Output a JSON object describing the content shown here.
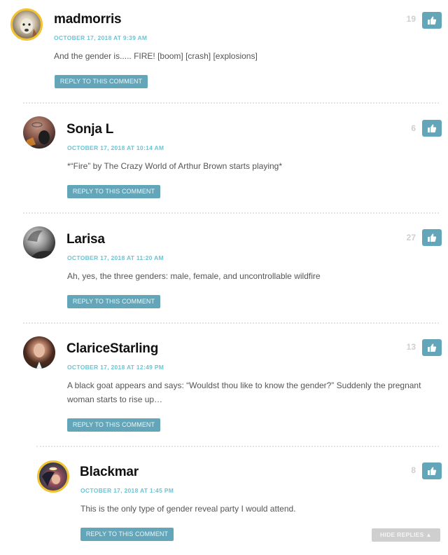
{
  "reply_label": "REPLY TO THIS COMMENT",
  "hide_replies_label": "HIDE REPLIES ▲",
  "accent_color": "#63a6b9",
  "date_color": "#6cc4d4",
  "comments": [
    {
      "author": "madmorris",
      "date": "OCTOBER 17, 2018 AT 9:39 AM",
      "text": "And the gender is..... FIRE! [boom] [crash] [explosions]",
      "likes": "19",
      "avatar": "alpaca-avatar"
    },
    {
      "author": "Sonja L",
      "date": "OCTOBER 17, 2018 AT 10:14 AM",
      "text": "*“Fire” by The Crazy World of Arthur Brown starts playing*",
      "likes": "6",
      "avatar": "user-photo-avatar"
    },
    {
      "author": "Larisa",
      "date": "OCTOBER 17, 2018 AT 11:20 AM",
      "text": "Ah, yes, the three genders: male, female, and uncontrollable wildfire",
      "likes": "27",
      "avatar": "bw-photo-avatar"
    },
    {
      "author": "ClariceStarling",
      "date": "OCTOBER 17, 2018 AT 12:49 PM",
      "text": "A black goat appears and says: “Wouldst thou like to know the gender?” Suddenly the pregnant woman starts to rise up…",
      "likes": "13",
      "avatar": "portrait-avatar"
    },
    {
      "author": "Blackmar",
      "date": "OCTOBER 17, 2018 AT 1:45 PM",
      "text": "This is the only type of gender reveal party I would attend.",
      "likes": "8",
      "avatar": "comic-art-avatar"
    }
  ]
}
